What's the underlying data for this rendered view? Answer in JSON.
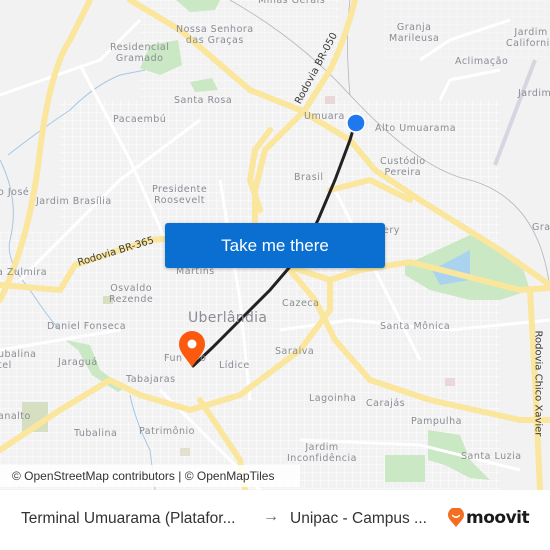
{
  "map": {
    "neighborhoods": [
      {
        "id": "minas-gerais",
        "text": "Minas Gerais"
      },
      {
        "id": "nossa-senhora",
        "text": "Nossa Senhora\ndas Graças"
      },
      {
        "id": "residencial-gramado",
        "text": "Residencial\nGramado"
      },
      {
        "id": "santa-rosa",
        "text": "Santa Rosa"
      },
      {
        "id": "pacaembu",
        "text": "Pacaembú"
      },
      {
        "id": "granja-marileusa",
        "text": "Granja\nMarileusa"
      },
      {
        "id": "jardim-california",
        "text": "Jardim\nCalifornia"
      },
      {
        "id": "aclimacao",
        "text": "Aclimação"
      },
      {
        "id": "jardim-east",
        "text": "Jardim"
      },
      {
        "id": "umuarama",
        "text": "Umuara"
      },
      {
        "id": "alto-umuarama",
        "text": "Alto Umuarama"
      },
      {
        "id": "custodio-pereira",
        "text": "Custódio\nPereira"
      },
      {
        "id": "brasil",
        "text": "Brasil"
      },
      {
        "id": "sao-jose",
        "text": "o José"
      },
      {
        "id": "jardim-brasilia",
        "text": "Jardim Brasília"
      },
      {
        "id": "presidente-roosevelt",
        "text": "Presidente\nRoosevelt"
      },
      {
        "id": "tibery",
        "text": "ery"
      },
      {
        "id": "gra",
        "text": "Gra"
      },
      {
        "id": "zulmira",
        "text": "a Zulmira"
      },
      {
        "id": "martins",
        "text": "Martins"
      },
      {
        "id": "osvaldo-rezende",
        "text": "Osvaldo\nRezende"
      },
      {
        "id": "cazeca",
        "text": "Cazeca"
      },
      {
        "id": "santa-monica",
        "text": "Santa Mônica"
      },
      {
        "id": "daniel-fonseca",
        "text": "Daniel Fonseca"
      },
      {
        "id": "tubalina-tel",
        "text": "ubalina\ntel"
      },
      {
        "id": "jaragua",
        "text": "Jaraguá"
      },
      {
        "id": "fundinho",
        "text": "Fun     o"
      },
      {
        "id": "lidice",
        "text": "Lídice"
      },
      {
        "id": "saraiva",
        "text": "Saraiva"
      },
      {
        "id": "tabajaras",
        "text": "Tabajaras"
      },
      {
        "id": "lagoinha",
        "text": "Lagoinha"
      },
      {
        "id": "carajas",
        "text": "Carajás"
      },
      {
        "id": "pampulha",
        "text": "Pampulha"
      },
      {
        "id": "planalto",
        "text": "analto"
      },
      {
        "id": "tubalina",
        "text": "Tubalina"
      },
      {
        "id": "patrimonio",
        "text": "Patrimônio"
      },
      {
        "id": "jardim-inconfidencia",
        "text": "Jardim\nInconfidência"
      },
      {
        "id": "santa-luzia",
        "text": "Santa Luzia"
      }
    ],
    "city_label": "Uberlândia",
    "roads": {
      "br050": "Rodovia BR-050",
      "br365": "Rodovia BR-365",
      "chico_xavier": "Rodovia Chico Xavier"
    },
    "route": {
      "origin_marker": "blue-dot",
      "destination_marker": "orange-pin",
      "route_color": "#222222",
      "origin_color": "#1f78f0",
      "destination_color": "#fb5a0e"
    },
    "attribution": "© OpenStreetMap contributors | © OpenMapTiles"
  },
  "cta": {
    "label": "Take me there",
    "color": "#0b6fd2"
  },
  "footer": {
    "from": "Terminal Umuarama (Platafor...",
    "arrow": "→",
    "to": "Unipac - Campus ...",
    "brand": "moovit",
    "brand_color": "#f26f21"
  }
}
